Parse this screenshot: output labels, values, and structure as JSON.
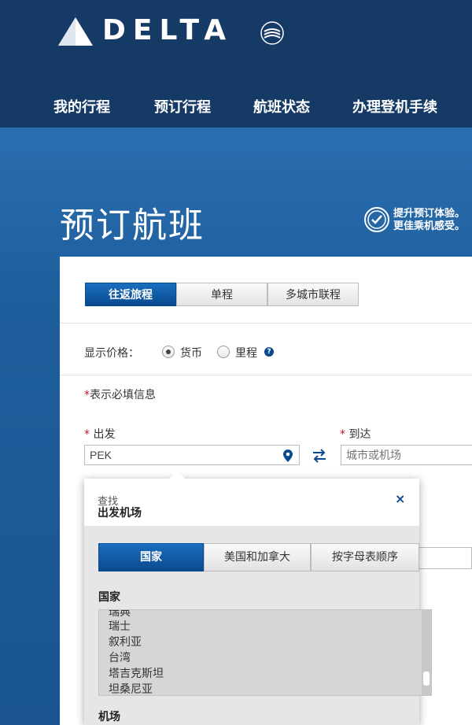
{
  "brand": {
    "logo_text": "DELTA",
    "alliance_text": "SKYTEAM"
  },
  "nav": {
    "items": [
      "我的行程",
      "预订行程",
      "航班状态",
      "办理登机手续"
    ]
  },
  "page": {
    "title": "预订航班",
    "promo_line1": "提升预订体验。",
    "promo_line2": "更佳乘机感受。"
  },
  "trip_tabs": {
    "items": [
      "往返旅程",
      "单程",
      "多城市联程"
    ],
    "active": 0
  },
  "price": {
    "label": "显示价格：",
    "options": [
      "货币",
      "里程"
    ],
    "selected": 0,
    "help_symbol": "?"
  },
  "required_note": {
    "asterisk": "*",
    "text": "表示必填信息"
  },
  "origin": {
    "asterisk": "*",
    "label": "出发",
    "value": "PEK"
  },
  "destination": {
    "asterisk": "*",
    "label": "到达",
    "placeholder": "城市或机场"
  },
  "airport_popup": {
    "subtitle": "查找",
    "title": "出发机场",
    "close_symbol": "×",
    "tabs": [
      "国家",
      "美国和加拿大",
      "按字母表顺序"
    ],
    "active_tab": 0,
    "country_label": "国家",
    "countries": [
      "瑞典",
      "瑞士",
      "叙利亚",
      "台湾",
      "塔吉克斯坦",
      "坦桑尼亚"
    ],
    "airport_label": "机场"
  },
  "colors": {
    "header_bg": "#163a66",
    "hero_bg": "#1e5d9c",
    "accent_blue": "#0a4a8e",
    "required_red": "#c8102e"
  }
}
